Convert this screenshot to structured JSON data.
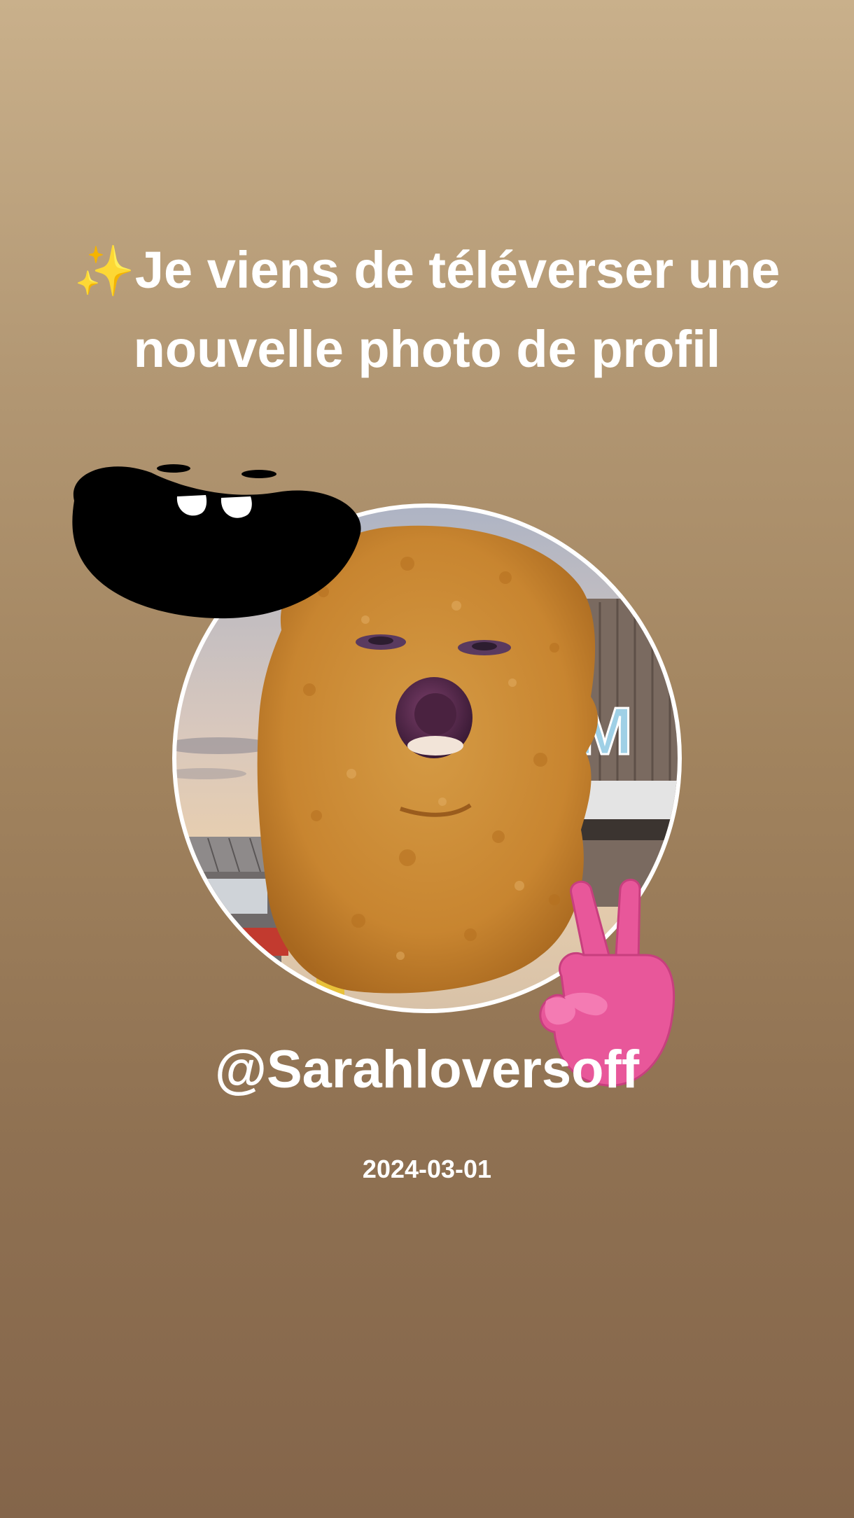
{
  "story": {
    "sparkle_emoji": "✨",
    "headline_text": "Je viens de téléverser une nouvelle photo de profil",
    "username": "@Sarahloversoff",
    "date": "2024-03-01",
    "profile_photo_sign_text": "M",
    "background_top_color": "#c9b08b",
    "background_bottom_color": "#84654a"
  }
}
